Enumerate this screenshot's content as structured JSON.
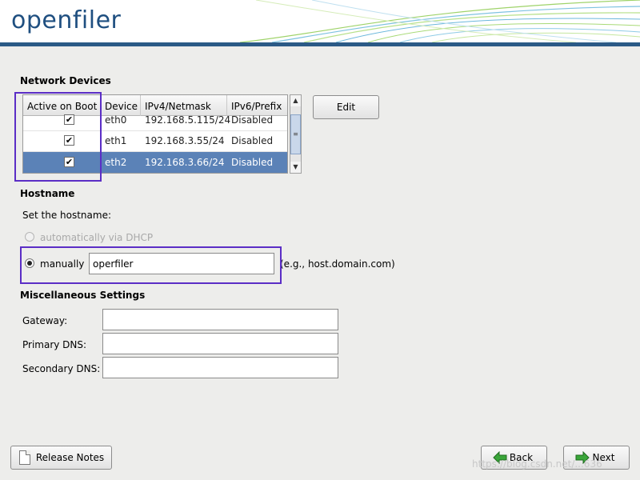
{
  "header": {
    "logo_text": "openfiler"
  },
  "network_devices": {
    "title": "Network Devices",
    "columns": [
      "Active on Boot",
      "Device",
      "IPv4/Netmask",
      "IPv6/Prefix"
    ],
    "rows": [
      {
        "active": true,
        "device": "eth0",
        "ipv4": "192.168.5.115/24",
        "ipv6": "Disabled",
        "selected": false
      },
      {
        "active": true,
        "device": "eth1",
        "ipv4": "192.168.3.55/24",
        "ipv6": "Disabled",
        "selected": false
      },
      {
        "active": true,
        "device": "eth2",
        "ipv4": "192.168.3.66/24",
        "ipv6": "Disabled",
        "selected": true
      }
    ],
    "edit_label": "Edit"
  },
  "hostname": {
    "title": "Hostname",
    "prompt": "Set the hostname:",
    "dhcp_label": "automatically via DHCP",
    "manual_label": "manually",
    "value": "operfiler",
    "example": "(e.g., host.domain.com)"
  },
  "misc": {
    "title": "Miscellaneous Settings",
    "gateway_label": "Gateway:",
    "gateway_value": "",
    "primary_dns_label": "Primary DNS:",
    "primary_dns_value": "",
    "secondary_dns_label": "Secondary DNS:",
    "secondary_dns_value": ""
  },
  "footer": {
    "release_notes_label": "Release Notes",
    "back_label": "Back",
    "next_label": "Next",
    "watermark": "https://blog.csdn.net/...636"
  },
  "colors": {
    "header_bar": "#2b5a86",
    "selection": "#5b82b7",
    "highlight_box": "#5b2ec6"
  }
}
